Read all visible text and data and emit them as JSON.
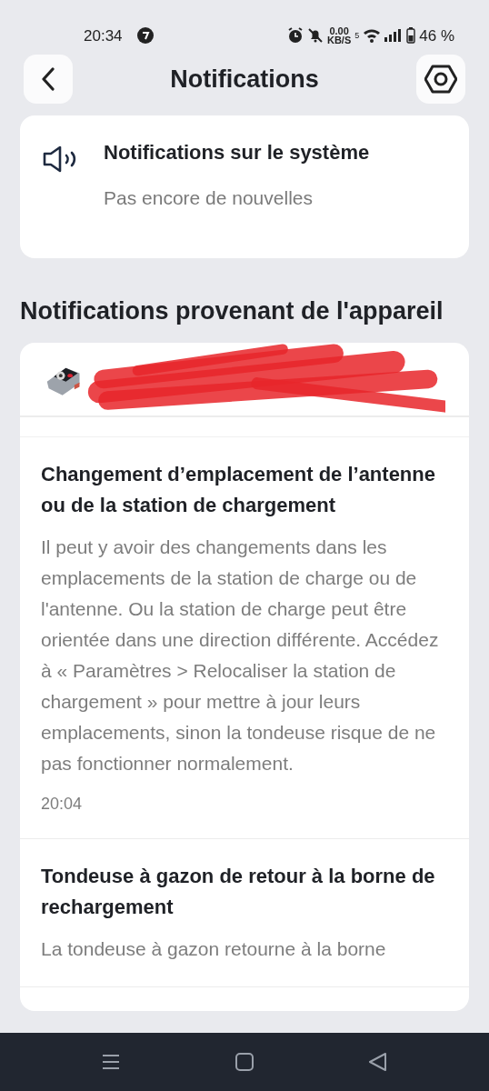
{
  "status_bar": {
    "time": "20:34",
    "network_speed": "0.00",
    "network_speed_unit": "KB/S",
    "wifi_band": "5",
    "battery": "46 %"
  },
  "header": {
    "title": "Notifications"
  },
  "system_card": {
    "title": "Notifications sur le système",
    "subtitle": "Pas encore de nouvelles"
  },
  "section_title": "Notifications provenant de l'appareil",
  "notifications": [
    {
      "title": "Changement d’emplacement de l’antenne ou de la station de chargement",
      "body": "Il peut y avoir des changements dans les emplacements de la station de charge ou de l'antenne. Ou la station de charge peut être orientée dans une direction différente. Accédez à « Paramètres > Relocaliser la station de chargement » pour mettre à jour leurs emplacements, sinon la tondeuse risque de ne pas fonctionner normalement.",
      "time": "20:04"
    },
    {
      "title": "Tondeuse à gazon de retour à la borne de rechargement",
      "body": "La tondeuse à gazon retourne à la borne"
    }
  ]
}
